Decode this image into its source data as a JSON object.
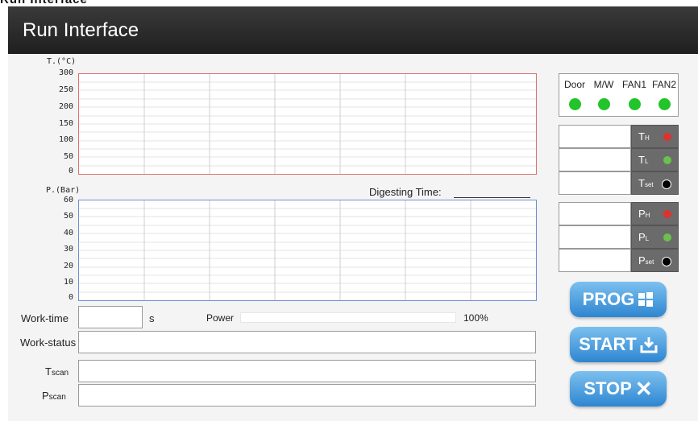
{
  "header": {
    "title": "Run Interface",
    "cut_text": "Run Interface"
  },
  "temp_chart": {
    "unit_label": "T.(°C)",
    "ticks": [
      "300",
      "250",
      "200",
      "150",
      "100",
      "50",
      "0"
    ]
  },
  "pressure_chart": {
    "unit_label": "P.(Bar)",
    "ticks": [
      "60",
      "50",
      "40",
      "30",
      "20",
      "10",
      "0"
    ],
    "digesting_label": "Digesting Time:"
  },
  "status": {
    "labels": [
      "Door",
      "M/W",
      "FAN1",
      "FAN2"
    ],
    "led_color": "#22c42a"
  },
  "temp_rows": [
    {
      "tag": "T",
      "sub": "H",
      "dot_color": "#e03030"
    },
    {
      "tag": "T",
      "sub": "L",
      "dot_color": "#6ac24a"
    },
    {
      "tag": "T",
      "sub": "set",
      "dot_color": "#000000"
    }
  ],
  "pressure_rows": [
    {
      "tag": "P",
      "sub": "H",
      "dot_color": "#e03030"
    },
    {
      "tag": "P",
      "sub": "L",
      "dot_color": "#6ac24a"
    },
    {
      "tag": "P",
      "sub": "set",
      "dot_color": "#000000"
    }
  ],
  "form": {
    "worktime_label": "Work-time",
    "worktime_unit": "s",
    "power_label": "Power",
    "power_value": "100%",
    "power_fraction": 1.0,
    "workstatus_label": "Work-status",
    "tscan_label": "T",
    "tscan_sub": "scan",
    "pscan_label": "P",
    "pscan_sub": "scan"
  },
  "buttons": {
    "prog_label": "PROG",
    "prog_icon": "windows-icon",
    "start_label": "START",
    "start_icon": "download-icon",
    "stop_label": "STOP",
    "stop_icon": "close-icon"
  }
}
